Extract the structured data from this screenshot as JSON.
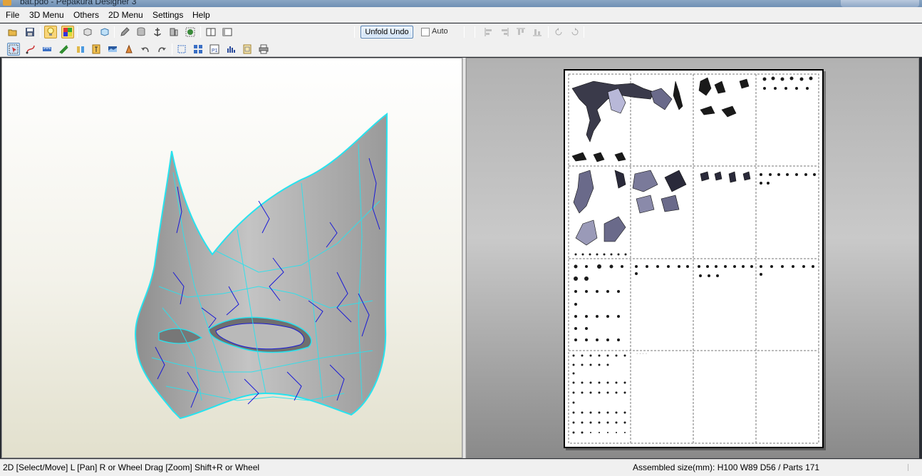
{
  "window": {
    "title": "bat.pdo - Pepakura Designer 3"
  },
  "menubar": {
    "items": [
      "File",
      "3D Menu",
      "Others",
      "2D Menu",
      "Settings",
      "Help"
    ]
  },
  "toolbar_top": {
    "unfold_undo_label": "Unfold Undo",
    "auto_label": "Auto",
    "auto_checked": false,
    "icons": [
      "open-icon",
      "save-icon",
      "light-bulb-icon",
      "texture-icon",
      "cube-icon",
      "flat-view-icon",
      "pencil-icon",
      "cylinder-icon",
      "anchor-icon",
      "panel-icon",
      "globe-icon",
      "single-window-icon",
      "split-window-icon",
      "align-left-icon",
      "align-right-icon",
      "align-top-icon",
      "align-bottom-icon",
      "rotate-left-90-icon",
      "rotate-right-90-icon"
    ]
  },
  "toolbar_bottom": {
    "icons": [
      "select-move-icon",
      "curve-icon",
      "ruler-icon",
      "edge-icon",
      "join-icon",
      "text-icon",
      "image-icon",
      "flap-icon",
      "undo-curve-icon",
      "redo-curve-icon",
      "arrange-icon",
      "grid-icon",
      "page-number-icon",
      "bar-chart-icon",
      "page-setup-icon",
      "print-icon"
    ]
  },
  "sheet": {
    "title_dots": "· · · ·"
  },
  "colors": {
    "model_fill": "#a8a8a8",
    "wire_cyan": "#26e3ef",
    "wire_blue": "#1a1ad6",
    "sheet_border": "#000000"
  },
  "statusbar": {
    "left_text": "2D [Select/Move] L [Pan] R or Wheel Drag [Zoom] Shift+R or Wheel",
    "right_text": "Assembled size(mm): H100 W89 D56 / Parts 171"
  }
}
